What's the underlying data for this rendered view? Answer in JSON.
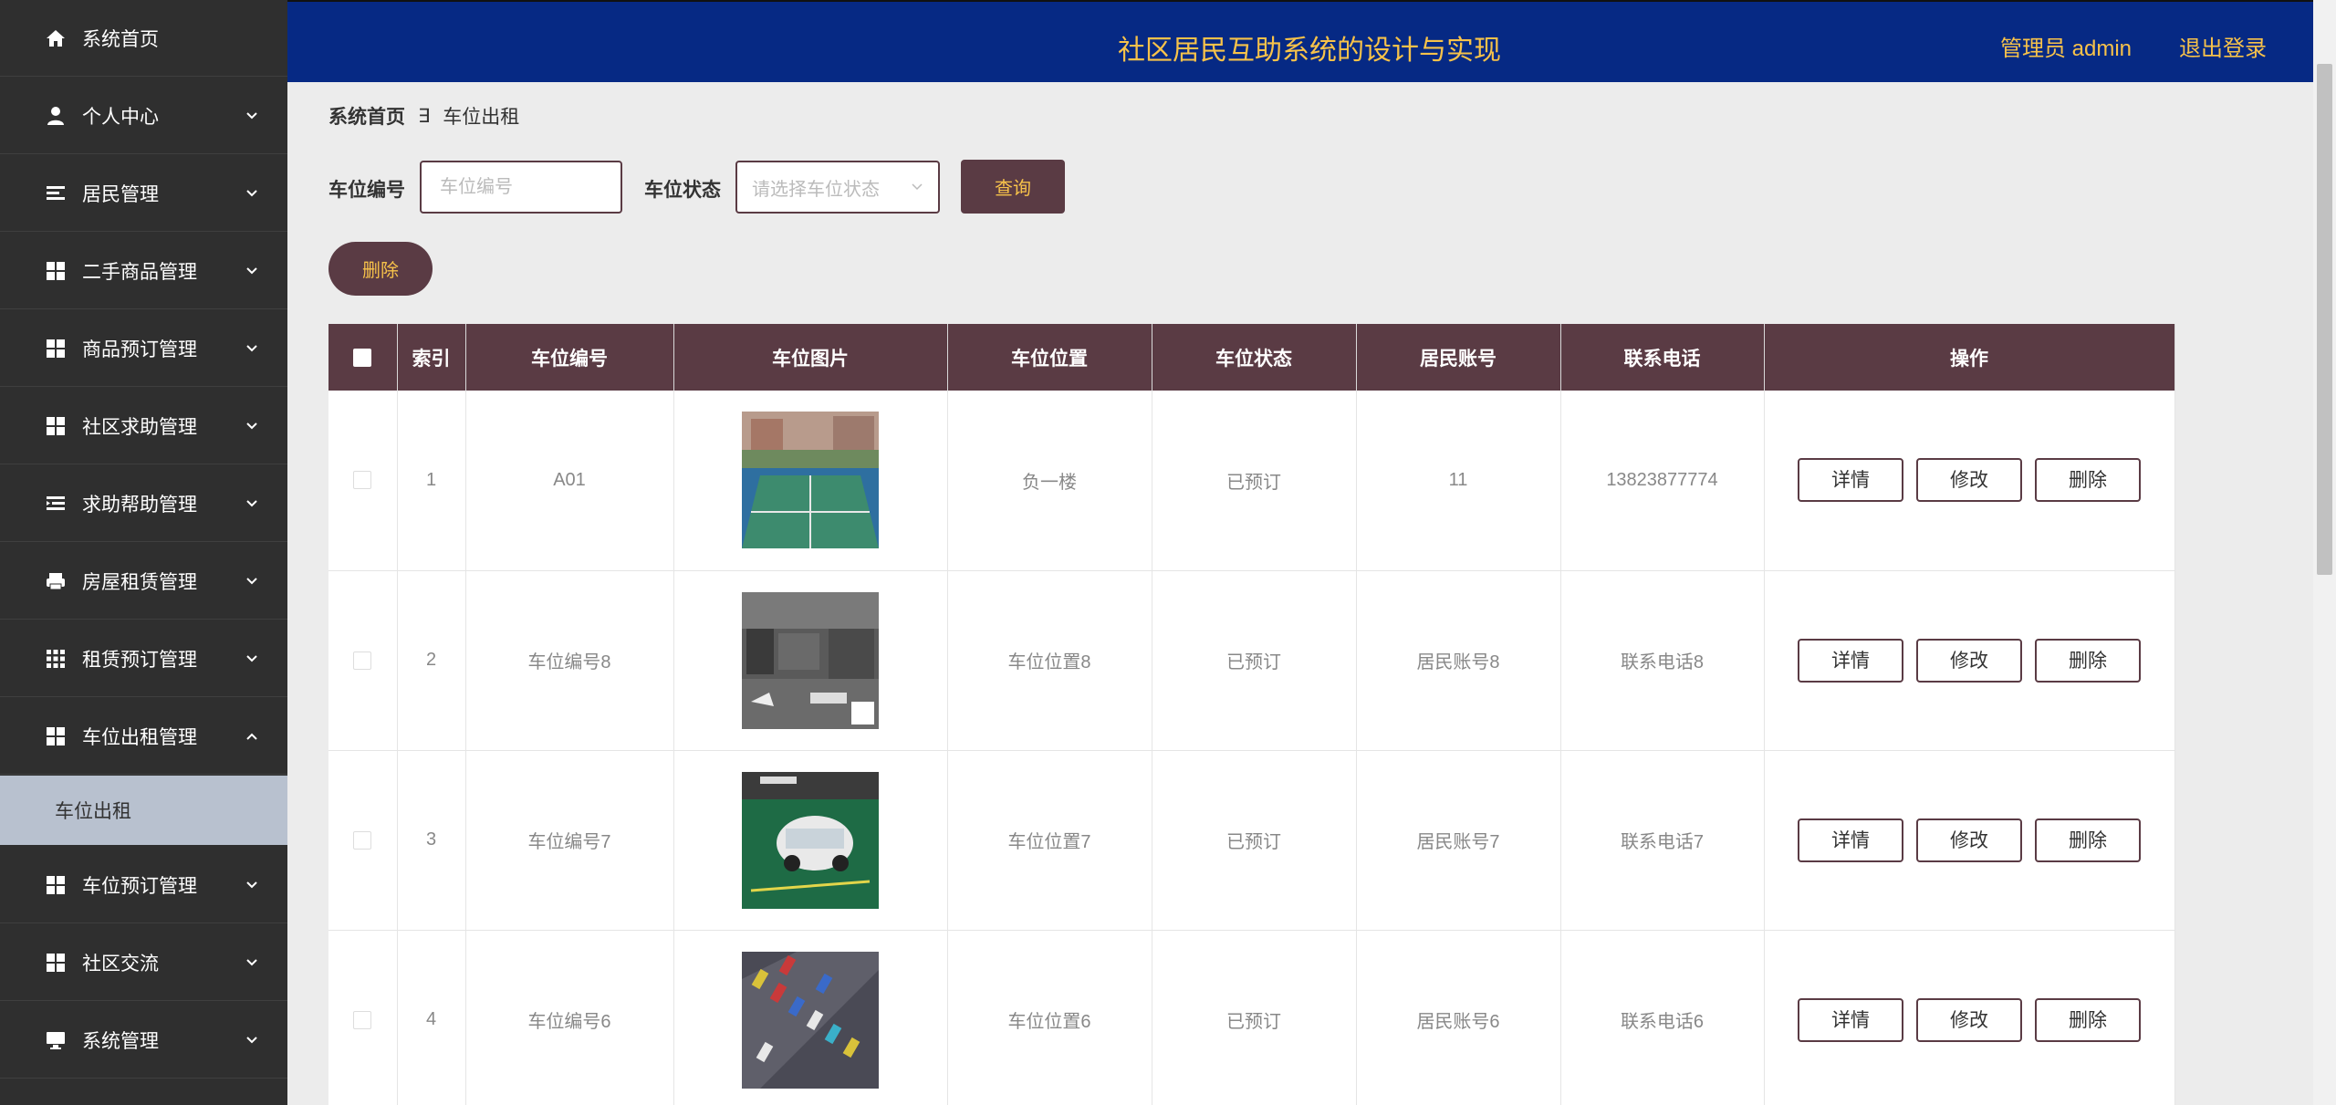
{
  "app": {
    "title": "社区居民互助系统的设计与实现",
    "user_label": "管理员 admin",
    "logout_label": "退出登录"
  },
  "sidebar": {
    "items": [
      {
        "label": "系统首页",
        "icon": "home-icon",
        "has_arrow": false
      },
      {
        "label": "个人中心",
        "icon": "user-icon",
        "has_arrow": true
      },
      {
        "label": "居民管理",
        "icon": "list-icon",
        "has_arrow": true
      },
      {
        "label": "二手商品管理",
        "icon": "grid-icon",
        "has_arrow": true
      },
      {
        "label": "商品预订管理",
        "icon": "grid-icon",
        "has_arrow": true
      },
      {
        "label": "社区求助管理",
        "icon": "grid-icon",
        "has_arrow": true
      },
      {
        "label": "求助帮助管理",
        "icon": "indent-list-icon",
        "has_arrow": true
      },
      {
        "label": "房屋租赁管理",
        "icon": "printer-icon",
        "has_arrow": true
      },
      {
        "label": "租赁预订管理",
        "icon": "grid-9-icon",
        "has_arrow": true
      },
      {
        "label": "车位出租管理",
        "icon": "grid-icon",
        "has_arrow": true,
        "expanded": true
      },
      {
        "label": "车位预订管理",
        "icon": "grid-icon",
        "has_arrow": true
      },
      {
        "label": "社区交流",
        "icon": "grid-icon",
        "has_arrow": true
      },
      {
        "label": "系统管理",
        "icon": "monitor-icon",
        "has_arrow": true
      }
    ],
    "active_sub": "车位出租"
  },
  "breadcrumb": {
    "home": "系统首页",
    "separator": "∃",
    "current": "车位出租"
  },
  "search": {
    "code_label": "车位编号",
    "code_placeholder": "车位编号",
    "status_label": "车位状态",
    "status_placeholder": "请选择车位状态",
    "query_label": "查询",
    "delete_label": "删除"
  },
  "table": {
    "columns": [
      "索引",
      "车位编号",
      "车位图片",
      "车位位置",
      "车位状态",
      "居民账号",
      "联系电话",
      "操作"
    ],
    "rows": [
      {
        "index": "1",
        "code": "A01",
        "image": "court-photo",
        "location": "负一楼",
        "status": "已预订",
        "account": "11",
        "phone": "13823877774"
      },
      {
        "index": "2",
        "code": "车位编号8",
        "image": "garage-photo",
        "location": "车位位置8",
        "status": "已预订",
        "account": "居民账号8",
        "phone": "联系电话8"
      },
      {
        "index": "3",
        "code": "车位编号7",
        "image": "car-photo",
        "location": "车位位置7",
        "status": "已预订",
        "account": "居民账号7",
        "phone": "联系电话7"
      },
      {
        "index": "4",
        "code": "车位编号6",
        "image": "aerial-lot-photo",
        "location": "车位位置6",
        "status": "已预订",
        "account": "居民账号6",
        "phone": "联系电话6"
      }
    ],
    "actions": {
      "detail": "详情",
      "edit": "修改",
      "delete": "删除"
    }
  },
  "colors": {
    "sidebar_bg": "#2f2f2f",
    "header_bg": "#062984",
    "accent_gold": "#f7c24a",
    "primary_maroon": "#5a3b44",
    "active_sub_bg": "#b8c1cf"
  }
}
